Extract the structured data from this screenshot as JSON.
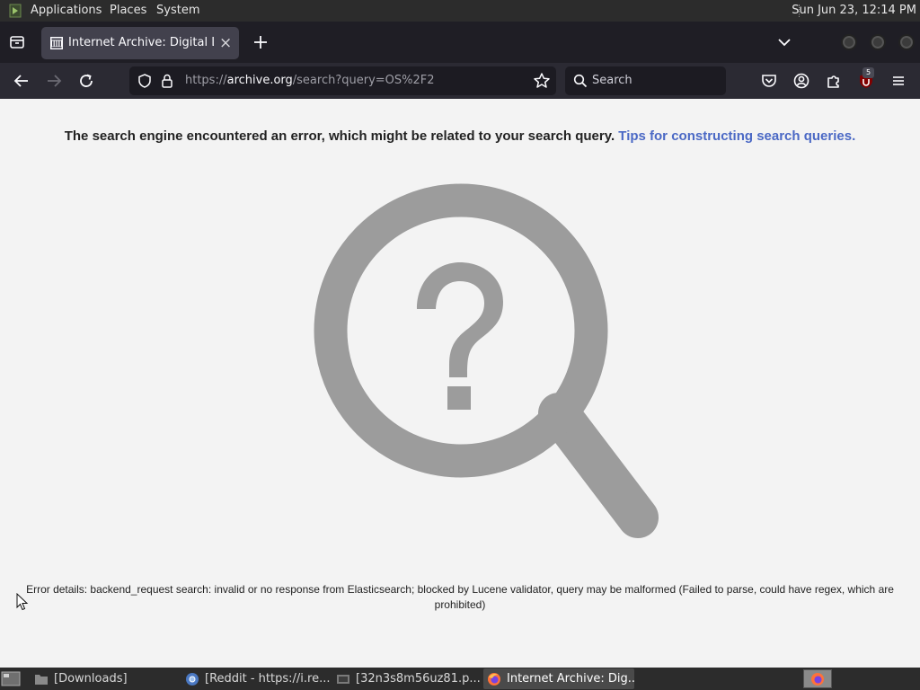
{
  "top_panel": {
    "menus": [
      "Applications",
      "Places",
      "System"
    ],
    "clock": "Sun Jun 23, 12:14 PM"
  },
  "browser": {
    "tab": {
      "title": "Internet Archive: Digital Libr",
      "close_glyph": "×"
    },
    "url": {
      "scheme": "https://",
      "host": "archive.org",
      "path": "/search?query=OS%2F2"
    },
    "search_placeholder": "Search",
    "extension_badge": "5"
  },
  "page": {
    "error_message": "The search engine encountered an error, which might be related to your search query.",
    "tips_link": "Tips for constructing search queries.",
    "error_details": "Error details: backend_request search: invalid or no response from Elasticsearch; blocked by Lucene validator, query may be malformed (Failed to parse, could have regex, which are prohibited)"
  },
  "taskbar": {
    "tasks": [
      {
        "label": "[Downloads]",
        "icon": "folder-icon",
        "active": false
      },
      {
        "label": "[Reddit - https://i.re...",
        "icon": "chromium-icon",
        "active": false
      },
      {
        "label": "[32n3s8m56uz81.p...",
        "icon": "image-viewer-icon",
        "active": false
      },
      {
        "label": "Internet Archive: Dig...",
        "icon": "firefox-icon",
        "active": true
      }
    ]
  },
  "colors": {
    "link": "#4b69c5",
    "magnifier": "#9c9c9c",
    "page_background": "#f3f3f3",
    "toolbar": "#2b2a33"
  }
}
